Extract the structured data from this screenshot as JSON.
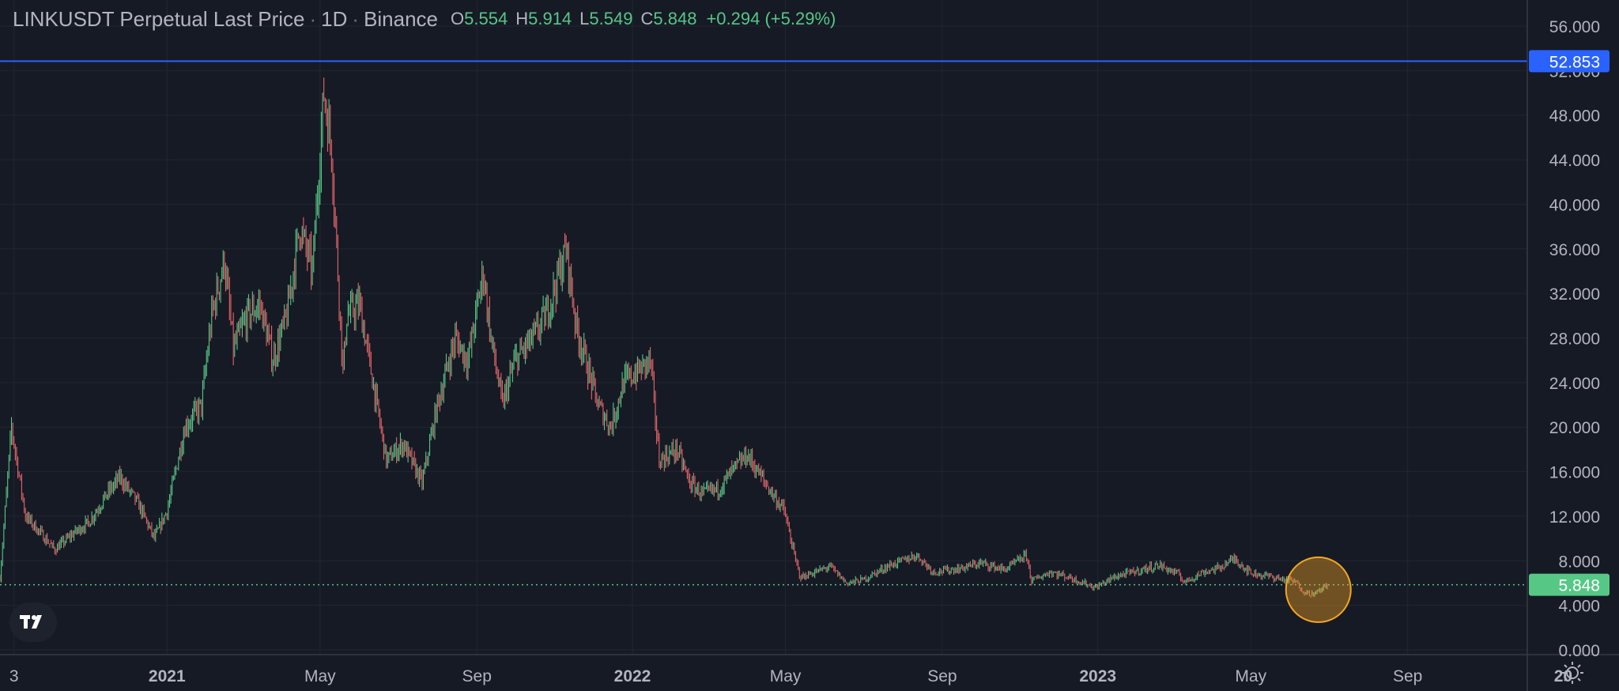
{
  "header": {
    "symbol": "LINKUSDT Perpetual Last Price",
    "interval": "1D",
    "exchange": "Binance",
    "dot": "·",
    "o_label": "O",
    "o_value": "5.554",
    "h_label": "H",
    "h_value": "5.914",
    "l_label": "L",
    "l_value": "5.549",
    "c_label": "C",
    "c_value": "5.848",
    "change": "+0.294 (+5.29%)"
  },
  "colors": {
    "background": "#161a25",
    "up": "#57c786",
    "down": "#e5656a",
    "grid": "#22262f",
    "axis_text": "#b2b5be",
    "horizontal_line": "#2962ff",
    "last_price": "#57c786",
    "highlight_circle": "#f5a623"
  },
  "icons": {
    "logo": "tradingview-logo-icon",
    "settings": "sun-settings-icon"
  },
  "chart_data": {
    "type": "candlestick",
    "y_axis": {
      "min": 0,
      "max": 56,
      "ticks": [
        "56.000",
        "52.000",
        "48.000",
        "44.000",
        "40.000",
        "36.000",
        "32.000",
        "28.000",
        "24.000",
        "20.000",
        "16.000",
        "12.000",
        "8.000",
        "4.000",
        "0.000"
      ]
    },
    "x_axis": {
      "range": [
        "2020-08-23",
        "2024-01-15"
      ],
      "ticks": [
        {
          "label": "3",
          "date": "2020-09-03",
          "bold": false
        },
        {
          "label": "2021",
          "date": "2021-01-01",
          "bold": true
        },
        {
          "label": "May",
          "date": "2021-05-01",
          "bold": false
        },
        {
          "label": "Sep",
          "date": "2021-09-01",
          "bold": false
        },
        {
          "label": "2022",
          "date": "2022-01-01",
          "bold": true
        },
        {
          "label": "May",
          "date": "2022-05-01",
          "bold": false
        },
        {
          "label": "Sep",
          "date": "2022-09-01",
          "bold": false
        },
        {
          "label": "2023",
          "date": "2023-01-01",
          "bold": true
        },
        {
          "label": "May",
          "date": "2023-05-01",
          "bold": false
        },
        {
          "label": "Sep",
          "date": "2023-09-01",
          "bold": false
        },
        {
          "label": "20",
          "date": "2024-01-01",
          "bold": true
        }
      ]
    },
    "horizontal_line": {
      "value": 52.853,
      "label": "52.853"
    },
    "last_price": {
      "value": 5.848,
      "label": "5.848"
    },
    "highlight": {
      "date": "2023-06-23",
      "value": 5.4
    },
    "close_path": [
      [
        "2020-08-23",
        6.5
      ],
      [
        "2020-09-01",
        20.0
      ],
      [
        "2020-09-12",
        12.0
      ],
      [
        "2020-09-20",
        11.0
      ],
      [
        "2020-10-05",
        9.0
      ],
      [
        "2020-10-20",
        10.5
      ],
      [
        "2020-11-01",
        11.5
      ],
      [
        "2020-11-15",
        14.0
      ],
      [
        "2020-11-25",
        15.5
      ],
      [
        "2020-12-10",
        13.0
      ],
      [
        "2020-12-22",
        10.0
      ],
      [
        "2021-01-01",
        12.5
      ],
      [
        "2021-01-15",
        20.0
      ],
      [
        "2021-01-28",
        22.0
      ],
      [
        "2021-02-05",
        30.0
      ],
      [
        "2021-02-15",
        35.0
      ],
      [
        "2021-02-22",
        27.0
      ],
      [
        "2021-03-05",
        30.0
      ],
      [
        "2021-03-15",
        31.0
      ],
      [
        "2021-03-25",
        26.0
      ],
      [
        "2021-04-05",
        30.0
      ],
      [
        "2021-04-15",
        38.0
      ],
      [
        "2021-04-25",
        34.0
      ],
      [
        "2021-05-04",
        50.0
      ],
      [
        "2021-05-10",
        45.0
      ],
      [
        "2021-05-19",
        25.0
      ],
      [
        "2021-05-22",
        30.0
      ],
      [
        "2021-06-01",
        31.0
      ],
      [
        "2021-06-10",
        25.0
      ],
      [
        "2021-06-22",
        17.0
      ],
      [
        "2021-07-05",
        18.5
      ],
      [
        "2021-07-20",
        15.0
      ],
      [
        "2021-08-01",
        22.0
      ],
      [
        "2021-08-15",
        28.0
      ],
      [
        "2021-08-25",
        26.0
      ],
      [
        "2021-09-06",
        34.0
      ],
      [
        "2021-09-12",
        28.0
      ],
      [
        "2021-09-21",
        22.0
      ],
      [
        "2021-10-01",
        26.0
      ],
      [
        "2021-10-15",
        28.0
      ],
      [
        "2021-10-25",
        30.0
      ],
      [
        "2021-11-05",
        34.0
      ],
      [
        "2021-11-10",
        36.0
      ],
      [
        "2021-11-18",
        29.0
      ],
      [
        "2021-12-05",
        22.0
      ],
      [
        "2021-12-15",
        20.0
      ],
      [
        "2021-12-25",
        24.0
      ],
      [
        "2022-01-05",
        25.0
      ],
      [
        "2022-01-15",
        26.0
      ],
      [
        "2022-01-22",
        17.0
      ],
      [
        "2022-02-05",
        18.0
      ],
      [
        "2022-02-15",
        15.0
      ],
      [
        "2022-02-25",
        14.0
      ],
      [
        "2022-03-10",
        14.5
      ],
      [
        "2022-03-20",
        16.0
      ],
      [
        "2022-04-01",
        17.5
      ],
      [
        "2022-04-15",
        15.0
      ],
      [
        "2022-04-30",
        12.5
      ],
      [
        "2022-05-09",
        8.0
      ],
      [
        "2022-05-13",
        6.5
      ],
      [
        "2022-05-25",
        7.0
      ],
      [
        "2022-06-05",
        7.5
      ],
      [
        "2022-06-18",
        6.0
      ],
      [
        "2022-07-01",
        6.3
      ],
      [
        "2022-07-20",
        7.5
      ],
      [
        "2022-08-12",
        8.5
      ],
      [
        "2022-08-25",
        7.0
      ],
      [
        "2022-09-15",
        7.3
      ],
      [
        "2022-10-01",
        7.8
      ],
      [
        "2022-10-20",
        7.2
      ],
      [
        "2022-11-06",
        8.5
      ],
      [
        "2022-11-10",
        6.2
      ],
      [
        "2022-11-25",
        7.0
      ],
      [
        "2022-12-10",
        6.5
      ],
      [
        "2022-12-30",
        5.6
      ],
      [
        "2023-01-15",
        6.6
      ],
      [
        "2023-02-05",
        7.2
      ],
      [
        "2023-02-18",
        7.6
      ],
      [
        "2023-03-05",
        6.8
      ],
      [
        "2023-03-10",
        6.1
      ],
      [
        "2023-03-25",
        7.0
      ],
      [
        "2023-04-05",
        7.3
      ],
      [
        "2023-04-18",
        8.2
      ],
      [
        "2023-05-01",
        6.9
      ],
      [
        "2023-05-20",
        6.5
      ],
      [
        "2023-06-05",
        6.1
      ],
      [
        "2023-06-12",
        5.2
      ],
      [
        "2023-06-20",
        5.0
      ],
      [
        "2023-06-30",
        5.85
      ]
    ]
  }
}
